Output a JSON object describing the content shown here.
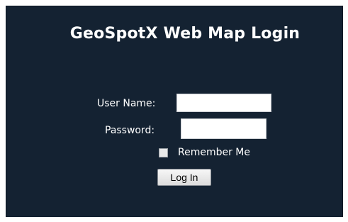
{
  "login": {
    "title": "GeoSpotX Web Map Login",
    "username_label": "User Name:",
    "username_value": "",
    "password_label": "Password:",
    "password_value": "",
    "remember_label": "Remember Me",
    "remember_checked": false,
    "submit_label": "Log In"
  },
  "colors": {
    "panel_background": "#142232",
    "text": "#ffffff"
  }
}
